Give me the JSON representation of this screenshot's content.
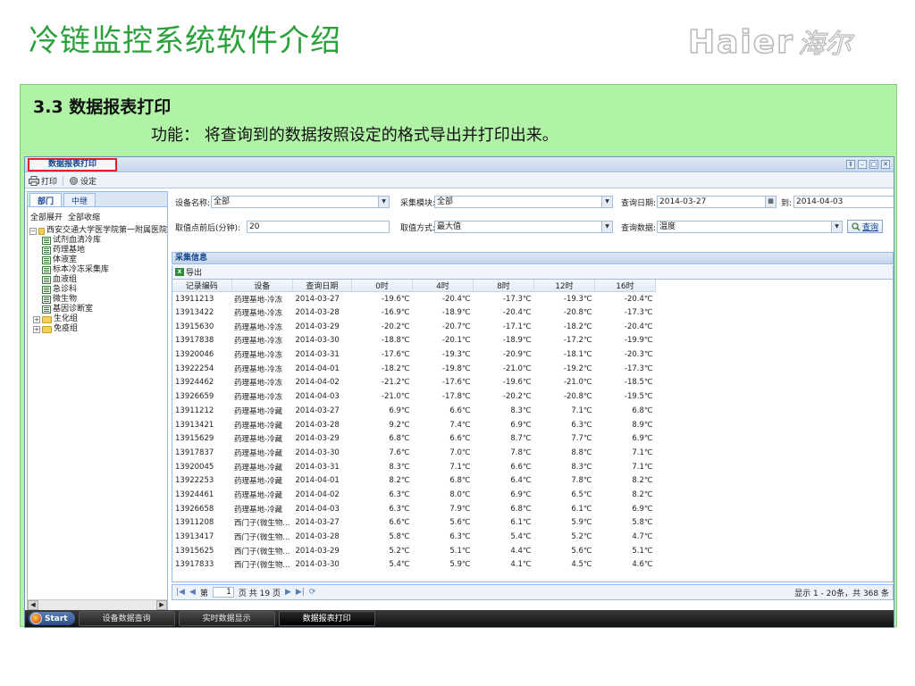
{
  "slide": {
    "title": "冷链监控系统软件介绍",
    "logo_latin": "Haier",
    "logo_cn": "海尔",
    "section_title": "3.3  数据报表打印",
    "section_func": "功能： 将查询到的数据按照设定的格式导出并打印出来。"
  },
  "app": {
    "tab_title": "数据报表打印",
    "window_controls": [
      "⇕",
      "–",
      "□",
      "✕"
    ],
    "toolbar": {
      "print_label": "打印",
      "settings_label": "设定"
    },
    "tree": {
      "tabs": [
        "部门",
        "中继"
      ],
      "expand_all": "全部展开",
      "collapse_all": "全部收缩",
      "root": "西安交通大学医学院第一附属医院",
      "leaves": [
        "试剂血清冷库",
        "药理基地",
        "体液室",
        "标本冷冻采集库",
        "血液组",
        "急诊科",
        "微生物",
        "基因诊断室"
      ],
      "folders": [
        "生化组",
        "免疫组"
      ]
    },
    "form": {
      "device_label": "设备名称:",
      "device_value": "全部",
      "module_label": "采集模块:",
      "module_value": "全部",
      "date_label": "查询日期:",
      "date_from": "2014-03-27",
      "to_label": "到:",
      "date_to": "2014-04-03",
      "interval_label": "取值点前后(分钟):",
      "interval_value": "20",
      "method_label": "取值方式:",
      "method_value": "最大值",
      "data_label": "查询数据:",
      "data_value": "温度",
      "query_button": "查询"
    },
    "info_header": "采集信息",
    "export_label": "导出",
    "columns": [
      "记录编码",
      "设备",
      "查询日期",
      "0时",
      "4时",
      "8时",
      "12时",
      "16时"
    ],
    "rows": [
      [
        "13911213",
        "药理基地-冷冻",
        "2014-03-27",
        "-19.6℃",
        "-20.4℃",
        "-17.3℃",
        "-19.3℃",
        "-20.4℃"
      ],
      [
        "13913422",
        "药理基地-冷冻",
        "2014-03-28",
        "-16.9℃",
        "-18.9℃",
        "-20.4℃",
        "-20.8℃",
        "-17.3℃"
      ],
      [
        "13915630",
        "药理基地-冷冻",
        "2014-03-29",
        "-20.2℃",
        "-20.7℃",
        "-17.1℃",
        "-18.2℃",
        "-20.4℃"
      ],
      [
        "13917838",
        "药理基地-冷冻",
        "2014-03-30",
        "-18.8℃",
        "-20.1℃",
        "-18.9℃",
        "-17.2℃",
        "-19.9℃"
      ],
      [
        "13920046",
        "药理基地-冷冻",
        "2014-03-31",
        "-17.6℃",
        "-19.3℃",
        "-20.9℃",
        "-18.1℃",
        "-20.3℃"
      ],
      [
        "13922254",
        "药理基地-冷冻",
        "2014-04-01",
        "-18.2℃",
        "-19.8℃",
        "-21.0℃",
        "-19.2℃",
        "-17.3℃"
      ],
      [
        "13924462",
        "药理基地-冷冻",
        "2014-04-02",
        "-21.2℃",
        "-17.6℃",
        "-19.6℃",
        "-21.0℃",
        "-18.5℃"
      ],
      [
        "13926659",
        "药理基地-冷冻",
        "2014-04-03",
        "-21.0℃",
        "-17.8℃",
        "-20.2℃",
        "-20.8℃",
        "-19.5℃"
      ],
      [
        "13911212",
        "药理基地-冷藏",
        "2014-03-27",
        "6.9℃",
        "6.6℃",
        "8.3℃",
        "7.1℃",
        "6.8℃"
      ],
      [
        "13913421",
        "药理基地-冷藏",
        "2014-03-28",
        "9.2℃",
        "7.4℃",
        "6.9℃",
        "6.3℃",
        "8.9℃"
      ],
      [
        "13915629",
        "药理基地-冷藏",
        "2014-03-29",
        "6.8℃",
        "6.6℃",
        "8.7℃",
        "7.7℃",
        "6.9℃"
      ],
      [
        "13917837",
        "药理基地-冷藏",
        "2014-03-30",
        "7.6℃",
        "7.0℃",
        "7.8℃",
        "8.8℃",
        "7.1℃"
      ],
      [
        "13920045",
        "药理基地-冷藏",
        "2014-03-31",
        "8.3℃",
        "7.1℃",
        "6.6℃",
        "8.3℃",
        "7.1℃"
      ],
      [
        "13922253",
        "药理基地-冷藏",
        "2014-04-01",
        "8.2℃",
        "6.8℃",
        "6.4℃",
        "7.8℃",
        "8.2℃"
      ],
      [
        "13924461",
        "药理基地-冷藏",
        "2014-04-02",
        "6.3℃",
        "8.0℃",
        "6.9℃",
        "6.5℃",
        "8.2℃"
      ],
      [
        "13926658",
        "药理基地-冷藏",
        "2014-04-03",
        "6.3℃",
        "7.9℃",
        "6.8℃",
        "6.1℃",
        "6.9℃"
      ],
      [
        "13911208",
        "西门子(微生物...",
        "2014-03-27",
        "6.6℃",
        "5.6℃",
        "6.1℃",
        "5.9℃",
        "5.8℃"
      ],
      [
        "13913417",
        "西门子(微生物...",
        "2014-03-28",
        "5.8℃",
        "6.3℃",
        "5.4℃",
        "5.2℃",
        "4.7℃"
      ],
      [
        "13915625",
        "西门子(微生物...",
        "2014-03-29",
        "5.2℃",
        "5.1℃",
        "4.4℃",
        "5.6℃",
        "5.1℃"
      ],
      [
        "13917833",
        "西门子(微生物...",
        "2014-03-30",
        "5.4℃",
        "5.9℃",
        "4.1℃",
        "4.5℃",
        "4.6℃"
      ]
    ],
    "pager": {
      "page_prefix": "第",
      "page_number": "1",
      "page_suffix": "页 共 19 页",
      "summary": "显示 1 - 20条，共 368 条"
    },
    "taskbar": {
      "start_label": "Start",
      "items": [
        "设备数据查询",
        "实时数据显示",
        "数据报表打印"
      ],
      "active_index": 2
    }
  }
}
